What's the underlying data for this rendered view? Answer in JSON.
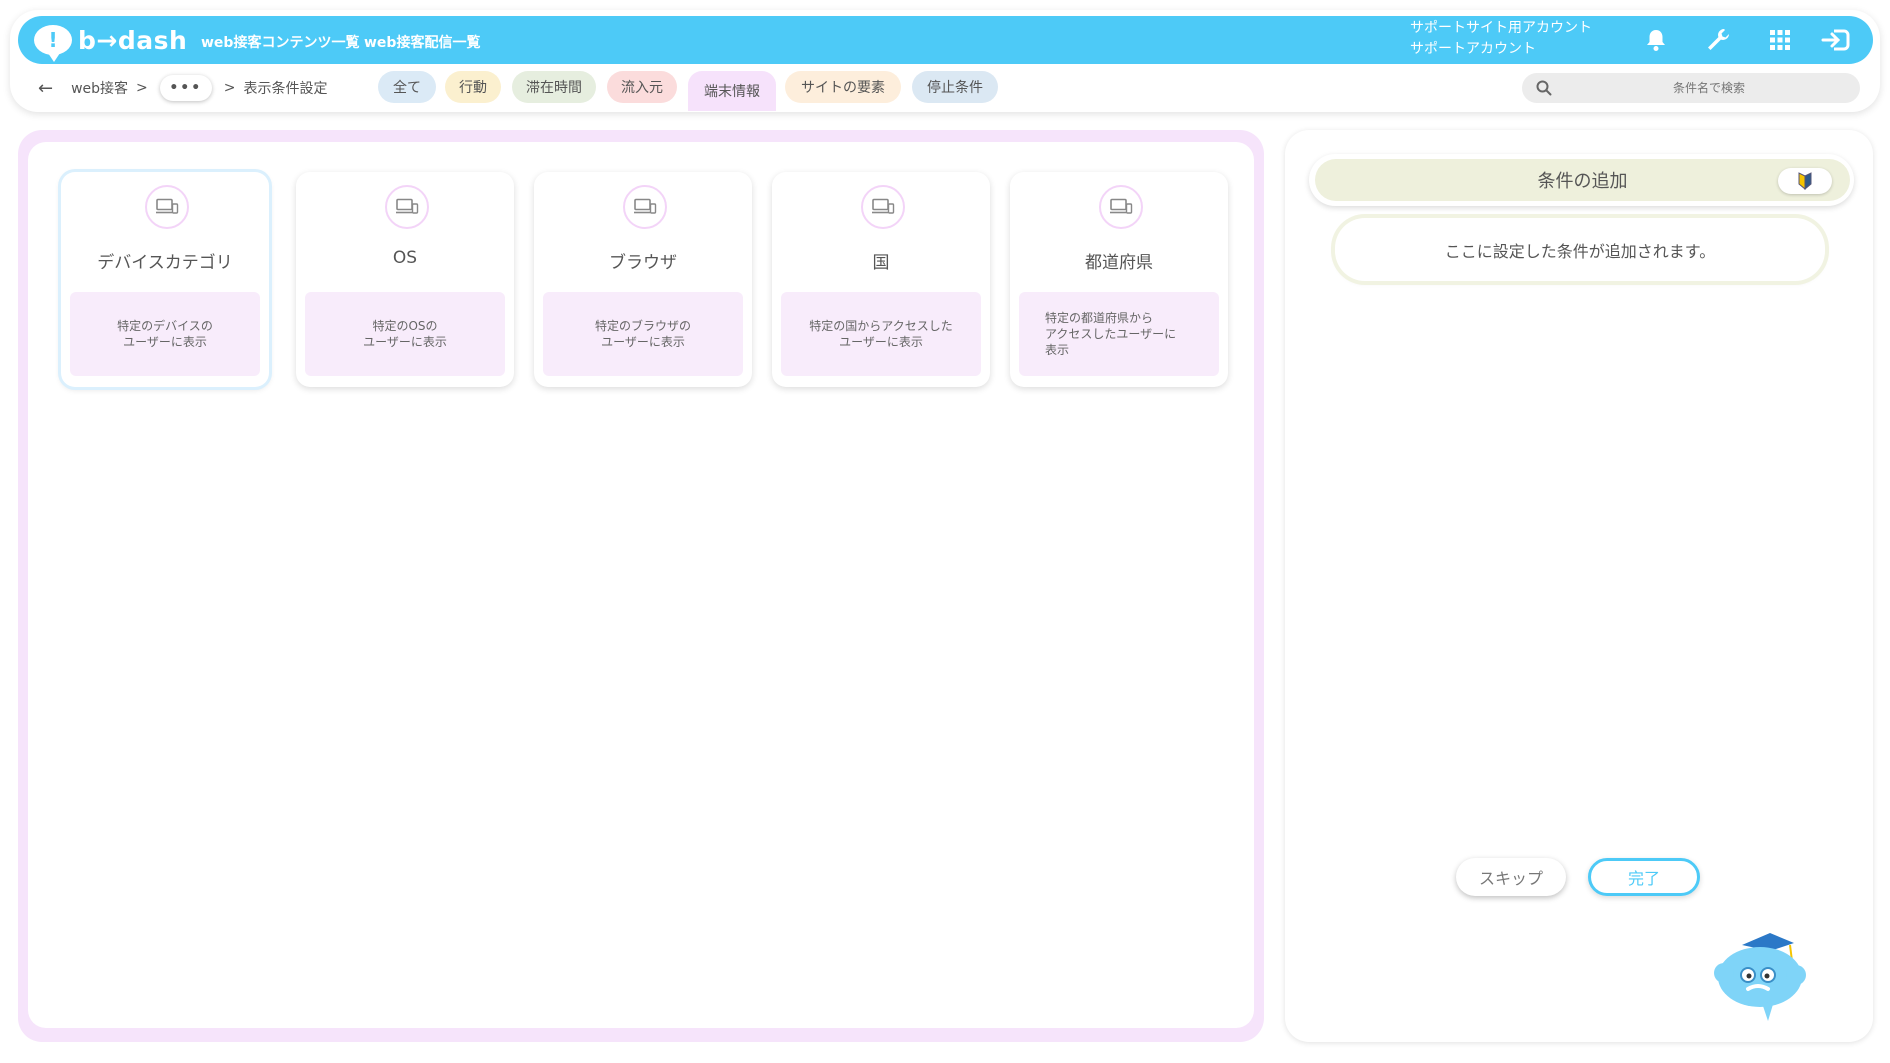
{
  "header": {
    "logo_text": "b→dash",
    "nav": [
      "web接客コンテンツ一覧",
      "web接客配信一覧"
    ],
    "account_line1": "サポートサイト用アカウント",
    "account_line2": "サポートアカウント",
    "icons": [
      "bell-icon",
      "wrench-icon",
      "grid-icon",
      "logout-icon"
    ],
    "accent_color": "#4dcaf7"
  },
  "breadcrumb": {
    "root": "web接客",
    "sep": ">",
    "more": "•••",
    "current": "表示条件設定"
  },
  "tabs": [
    {
      "label": "全て",
      "color": "#dbeaf6"
    },
    {
      "label": "行動",
      "color": "#fbf0cf"
    },
    {
      "label": "滞在時間",
      "color": "#e6eedf"
    },
    {
      "label": "流入元",
      "color": "#fbdcdc"
    },
    {
      "label": "端末情報",
      "color": "#f6e2fb",
      "active": true
    },
    {
      "label": "サイトの要素",
      "color": "#fdeedc"
    },
    {
      "label": "停止条件",
      "color": "#dbe8f3"
    }
  ],
  "search": {
    "placeholder": "条件名で検索"
  },
  "cards": [
    {
      "title": "デバイスカテゴリ",
      "desc": "特定のデバイスの\nユーザーに表示",
      "selected": true
    },
    {
      "title": "OS",
      "desc": "特定のOSの\nユーザーに表示"
    },
    {
      "title": "ブラウザ",
      "desc": "特定のブラウザの\nユーザーに表示"
    },
    {
      "title": "国",
      "desc": "特定の国からアクセスした\nユーザーに表示"
    },
    {
      "title": "都道府県",
      "desc": "特定の都道府県から\nアクセスしたユーザーに\n表示"
    }
  ],
  "right_panel": {
    "title": "条件の追加",
    "drop_text": "ここに設定した条件が追加されます。",
    "skip_label": "スキップ",
    "done_label": "完了"
  }
}
